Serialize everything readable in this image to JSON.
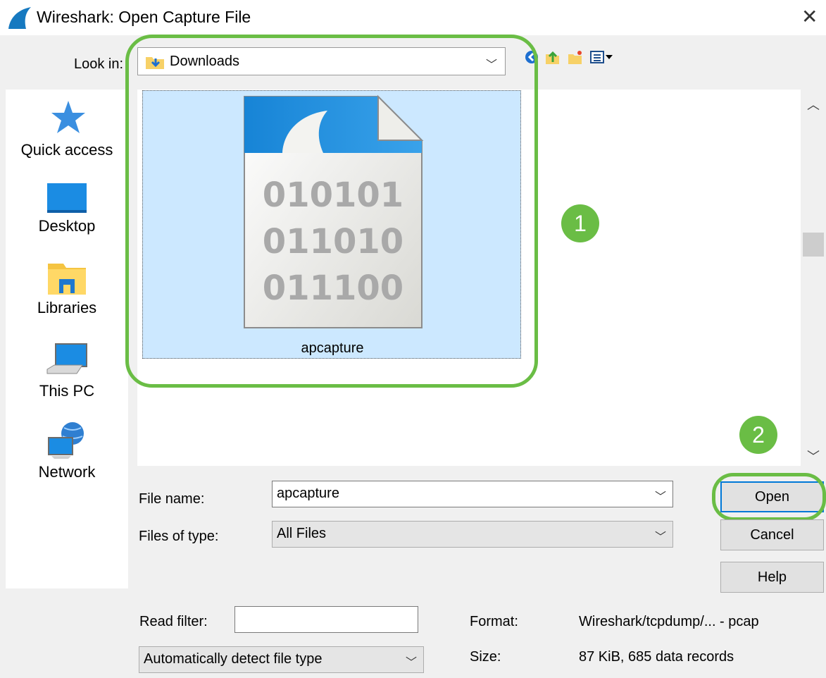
{
  "window": {
    "title": "Wireshark: Open Capture File",
    "close_glyph": "✕"
  },
  "lookin": {
    "label": "Look in:",
    "value": "Downloads"
  },
  "toolbar_icons": [
    "back-icon",
    "up-folder-icon",
    "new-folder-icon",
    "view-menu-icon"
  ],
  "places": [
    {
      "label": "Quick access",
      "icon": "quick-access-star-icon"
    },
    {
      "label": "Desktop",
      "icon": "desktop-icon"
    },
    {
      "label": "Libraries",
      "icon": "libraries-icon"
    },
    {
      "label": "This PC",
      "icon": "this-pc-icon"
    },
    {
      "label": "Network",
      "icon": "network-icon"
    }
  ],
  "files": [
    {
      "name": "apcapture",
      "icon": "capture-file-icon",
      "binary_lines": [
        "010101",
        "011010",
        "011100"
      ],
      "selected": true
    }
  ],
  "annotations": {
    "step1": "1",
    "step2": "2",
    "color": "#6abd45"
  },
  "form": {
    "file_name_label": "File name:",
    "file_name_value": "apcapture",
    "files_of_type_label": "Files of type:",
    "files_of_type_value": "All Files",
    "read_filter_label": "Read filter:",
    "read_filter_value": "",
    "detect_type_value": "Automatically detect file type"
  },
  "buttons": {
    "open": "Open",
    "cancel": "Cancel",
    "help": "Help"
  },
  "info": {
    "format_label": "Format:",
    "format_value": "Wireshark/tcpdump/... - pcap",
    "size_label": "Size:",
    "size_value": "87 KiB, 685 data records"
  },
  "colors": {
    "selection": "#cce8ff",
    "accent": "#0078d7",
    "annotation": "#6abd45"
  }
}
